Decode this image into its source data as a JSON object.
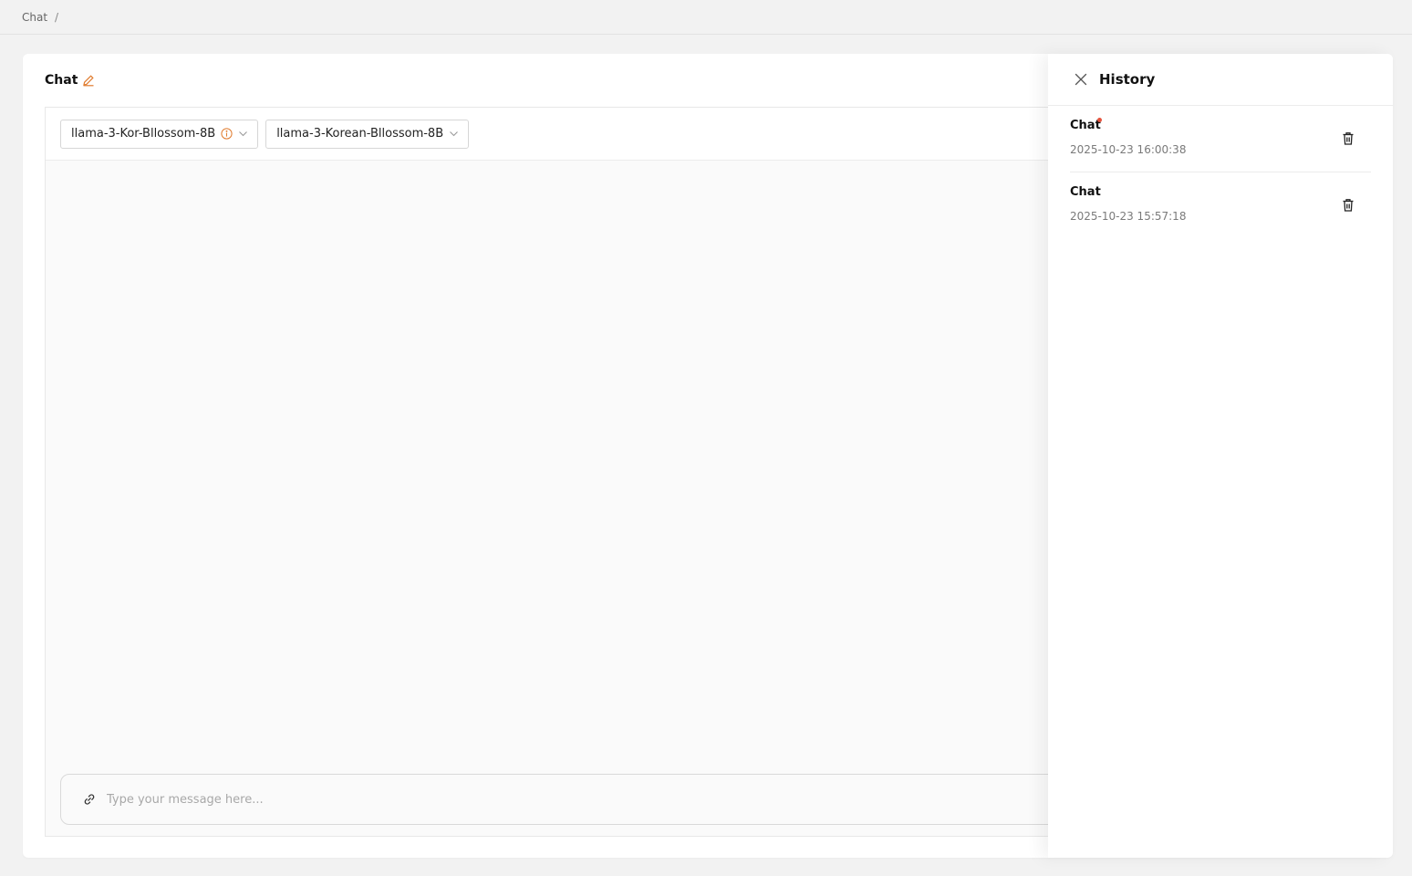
{
  "breadcrumb": {
    "items": [
      "Chat"
    ],
    "separator": "/"
  },
  "panel": {
    "title": "Chat",
    "edit_icon": "pencil-icon"
  },
  "models": [
    {
      "label": "llama-3-Kor-Bllossom-8B",
      "has_info": true
    },
    {
      "label": "llama-3-Korean-Bllossom-8B",
      "has_info": false
    }
  ],
  "composer": {
    "placeholder": "Type your message here...",
    "attach_icon": "link-icon"
  },
  "history": {
    "title": "History",
    "items": [
      {
        "title": "Chat",
        "time": "2025-10-23 16:00:38",
        "unread": true
      },
      {
        "title": "Chat",
        "time": "2025-10-23 15:57:18",
        "unread": false
      }
    ]
  },
  "colors": {
    "accent": "#e07b2e",
    "unread_dot": "#e5533d",
    "background": "#f2f2f2"
  }
}
